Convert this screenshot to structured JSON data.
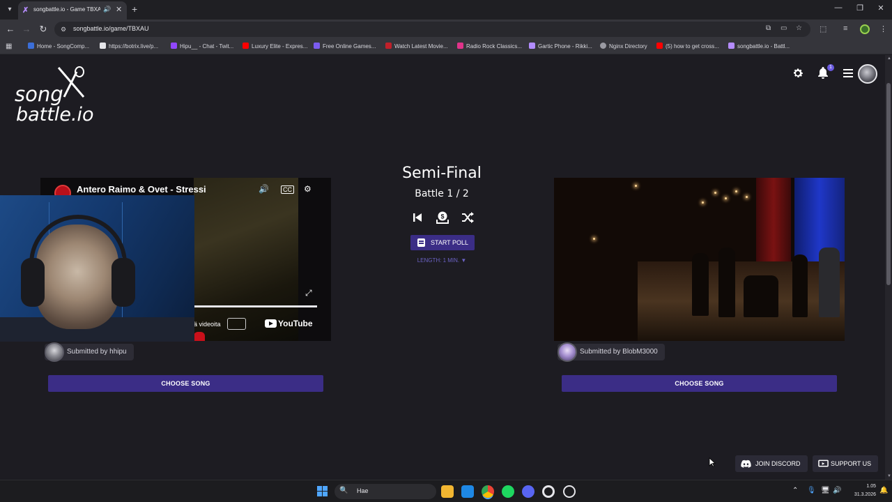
{
  "browser": {
    "tab_title": "songbattle.io - Game TBXAU",
    "url": "songbattle.io/game/TBXAU",
    "bookmarks": [
      {
        "label": "Home - SongComp...",
        "color": "#3b6ed8"
      },
      {
        "label": "https://botrix.live/p...",
        "color": "#e6e6ea"
      },
      {
        "label": "Hipu__ - Chat - Twit...",
        "color": "#9147ff"
      },
      {
        "label": "Luxury Elite - Expres...",
        "color": "#ff0000"
      },
      {
        "label": "Free Online Games...",
        "color": "#7b5cf0"
      },
      {
        "label": "Watch Latest Movie...",
        "color": "#c0202a"
      },
      {
        "label": "Radio Rock Classics...",
        "color": "#e0338a"
      },
      {
        "label": "Gartic Phone - Rikki...",
        "color": "#b28cff"
      },
      {
        "label": "Nginx Directory",
        "color": "#9a9aa2"
      },
      {
        "label": "(5) how to get cross...",
        "color": "#ff0000"
      },
      {
        "label": "songbattle.io - Battl...",
        "color": "#b58cff"
      }
    ]
  },
  "header": {
    "logo_line1": "song",
    "logo_line2": "battle.io",
    "notification_count": "1"
  },
  "round": {
    "title": "Semi-Final",
    "battle": "Battle 1 / 2",
    "start_poll": "START POLL",
    "length": "LENGTH: 1 MIN. ▼"
  },
  "left_song": {
    "video_title": "Antero Raimo & Ovet - Stressi",
    "watch_text": "ä videoita",
    "youtube_label": "YouTube",
    "submitted_by": "Submitted by hhipu",
    "choose": "CHOOSE SONG"
  },
  "right_song": {
    "submitted_by": "Submitted by BlobM3000",
    "choose": "CHOOSE SONG"
  },
  "footer": {
    "discord": "JOIN DISCORD",
    "support": "SUPPORT US"
  },
  "taskbar": {
    "search_placeholder": "Hae",
    "time": "1.05",
    "date": "31.3.2026"
  },
  "colors": {
    "background": "#1d1c22",
    "accent": "#3b2d86",
    "length_text": "#6b62c4"
  }
}
